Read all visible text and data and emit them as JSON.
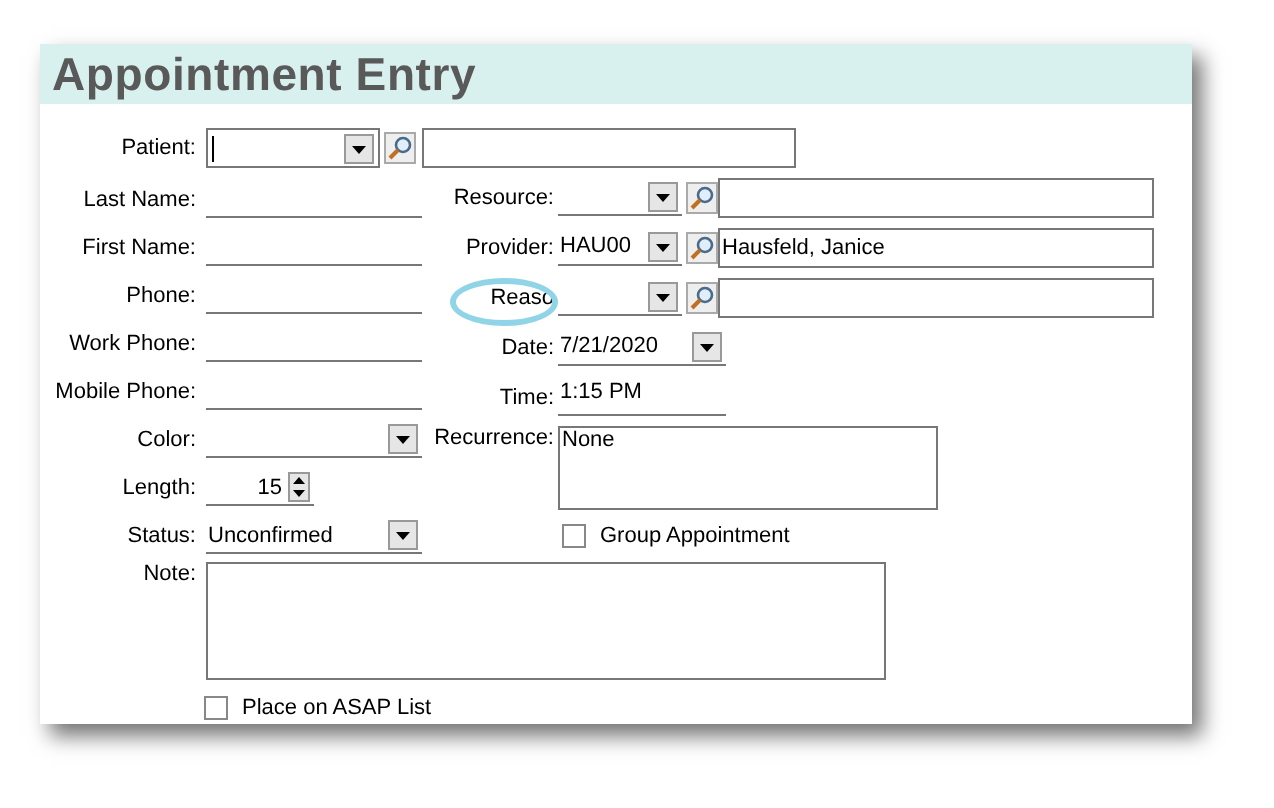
{
  "window": {
    "title": "Appointment Entry"
  },
  "patient": {
    "label": "Patient:",
    "focused": true
  },
  "left_fields": [
    {
      "kind": "line",
      "label": "Last Name:"
    },
    {
      "kind": "line",
      "label": "First Name:"
    },
    {
      "kind": "line",
      "label": "Phone:"
    },
    {
      "kind": "line",
      "label": "Work Phone:"
    },
    {
      "kind": "line",
      "label": "Mobile Phone:"
    },
    {
      "kind": "combo",
      "label": "Color:"
    },
    {
      "kind": "spin",
      "label": "Length:",
      "value": "15"
    },
    {
      "kind": "combo",
      "label": "Status:",
      "value": "Unconfirmed"
    }
  ],
  "right_fields": [
    {
      "kind": "lookup",
      "label": "Resource:",
      "highlighted": false
    },
    {
      "kind": "lookup",
      "label": "Provider:",
      "value": "HAU00",
      "name": "Hausfeld, Janice",
      "highlighted": false
    },
    {
      "kind": "lookup",
      "label": "Reaso",
      "highlighted": true
    },
    {
      "kind": "combo",
      "label": "Date:",
      "value": "7/21/2020"
    },
    {
      "kind": "line",
      "label": "Time:",
      "value": "1:15 PM"
    },
    {
      "kind": "memo",
      "label": "Recurrence:",
      "value": "None"
    }
  ],
  "group_appointment": {
    "label": "Group Appointment",
    "checked": false
  },
  "note": {
    "label": "Note:"
  },
  "asap": {
    "label": "Place on ASAP List",
    "checked": false
  }
}
